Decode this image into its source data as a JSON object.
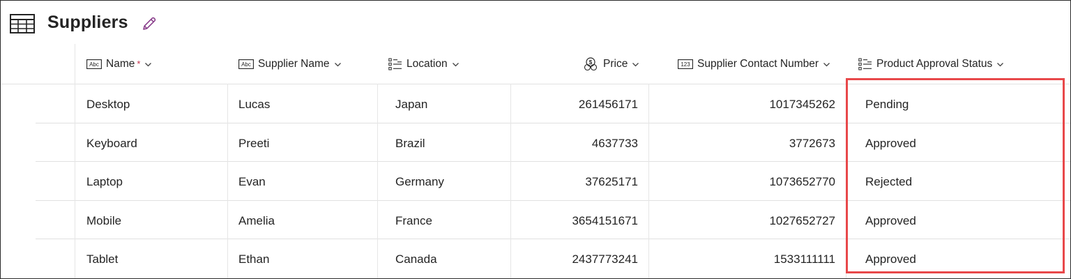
{
  "title": "Suppliers",
  "columns": [
    {
      "key": "name",
      "label": "Name",
      "required_mark": "*",
      "type_icon": "abc-text-icon"
    },
    {
      "key": "supplier",
      "label": "Supplier Name",
      "type_icon": "abc-text-icon"
    },
    {
      "key": "location",
      "label": "Location",
      "type_icon": "choice-list-icon"
    },
    {
      "key": "price",
      "label": "Price",
      "type_icon": "currency-icon"
    },
    {
      "key": "contact",
      "label": "Supplier Contact Number",
      "type_icon": "number-123-icon"
    },
    {
      "key": "status",
      "label": "Product Approval Status",
      "type_icon": "choice-list-icon"
    }
  ],
  "rows": [
    {
      "name": "Desktop",
      "supplier": "Lucas",
      "location": "Japan",
      "price": "261456171",
      "contact": "1017345262",
      "status": "Pending"
    },
    {
      "name": "Keyboard",
      "supplier": "Preeti",
      "location": "Brazil",
      "price": "4637733",
      "contact": "3772673",
      "status": "Approved"
    },
    {
      "name": "Laptop",
      "supplier": "Evan",
      "location": "Germany",
      "price": "37625171",
      "contact": "1073652770",
      "status": "Rejected"
    },
    {
      "name": "Mobile",
      "supplier": "Amelia",
      "location": "France",
      "price": "3654151671",
      "contact": "1027652727",
      "status": "Approved"
    },
    {
      "name": "Tablet",
      "supplier": "Ethan",
      "location": "Canada",
      "price": "2437773241",
      "contact": "1533111111",
      "status": "Approved"
    }
  ],
  "icons": {
    "table": "table-grid-icon",
    "edit": "pencil-icon",
    "dropdown": "chevron-down-icon"
  },
  "colors": {
    "required": "#c4314b",
    "highlight": "#e8484a",
    "edit_icon": "#8a3f8c"
  }
}
